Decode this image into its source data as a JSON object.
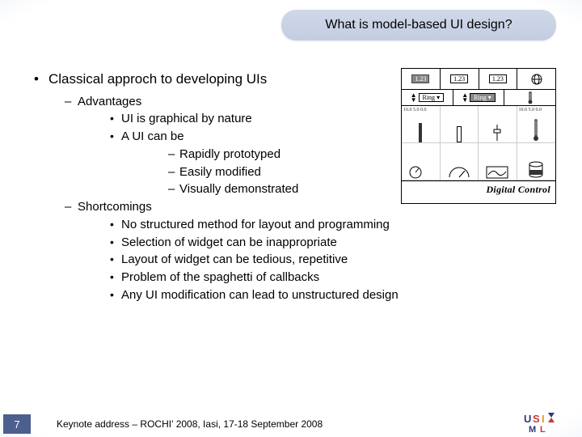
{
  "title": "What is model-based UI design?",
  "bullets": {
    "main": "Classical approch to developing UIs",
    "advantages": {
      "label": "Advantages",
      "items": {
        "a1": "UI is graphical by nature",
        "a2": "A UI can be",
        "sub": {
          "s1": "Rapidly prototyped",
          "s2": "Easily modified",
          "s3": "Visually demonstrated"
        }
      }
    },
    "shortcomings": {
      "label": "Shortcomings",
      "items": {
        "b1": "No structured method for layout and programming",
        "b2": "Selection of widget can be inappropriate",
        "b3": "Layout of widget can be tedious, repetitive",
        "b4": "Problem of the spaghetti of callbacks",
        "b5": "Any UI modification can lead to unstructured design"
      }
    }
  },
  "figure": {
    "top_labels": {
      "t1": "1.23",
      "t2": "1.23",
      "t3": "1.23"
    },
    "ring_label": "Ring",
    "gauge_ticks": "10.0\n5.0\n0.0",
    "caption": "Digital Control"
  },
  "footer": {
    "page": "7",
    "text": "Keynote address – ROCHI' 2008, Iasi, 17-18 September 2008"
  },
  "logo_name": "UsiXML"
}
